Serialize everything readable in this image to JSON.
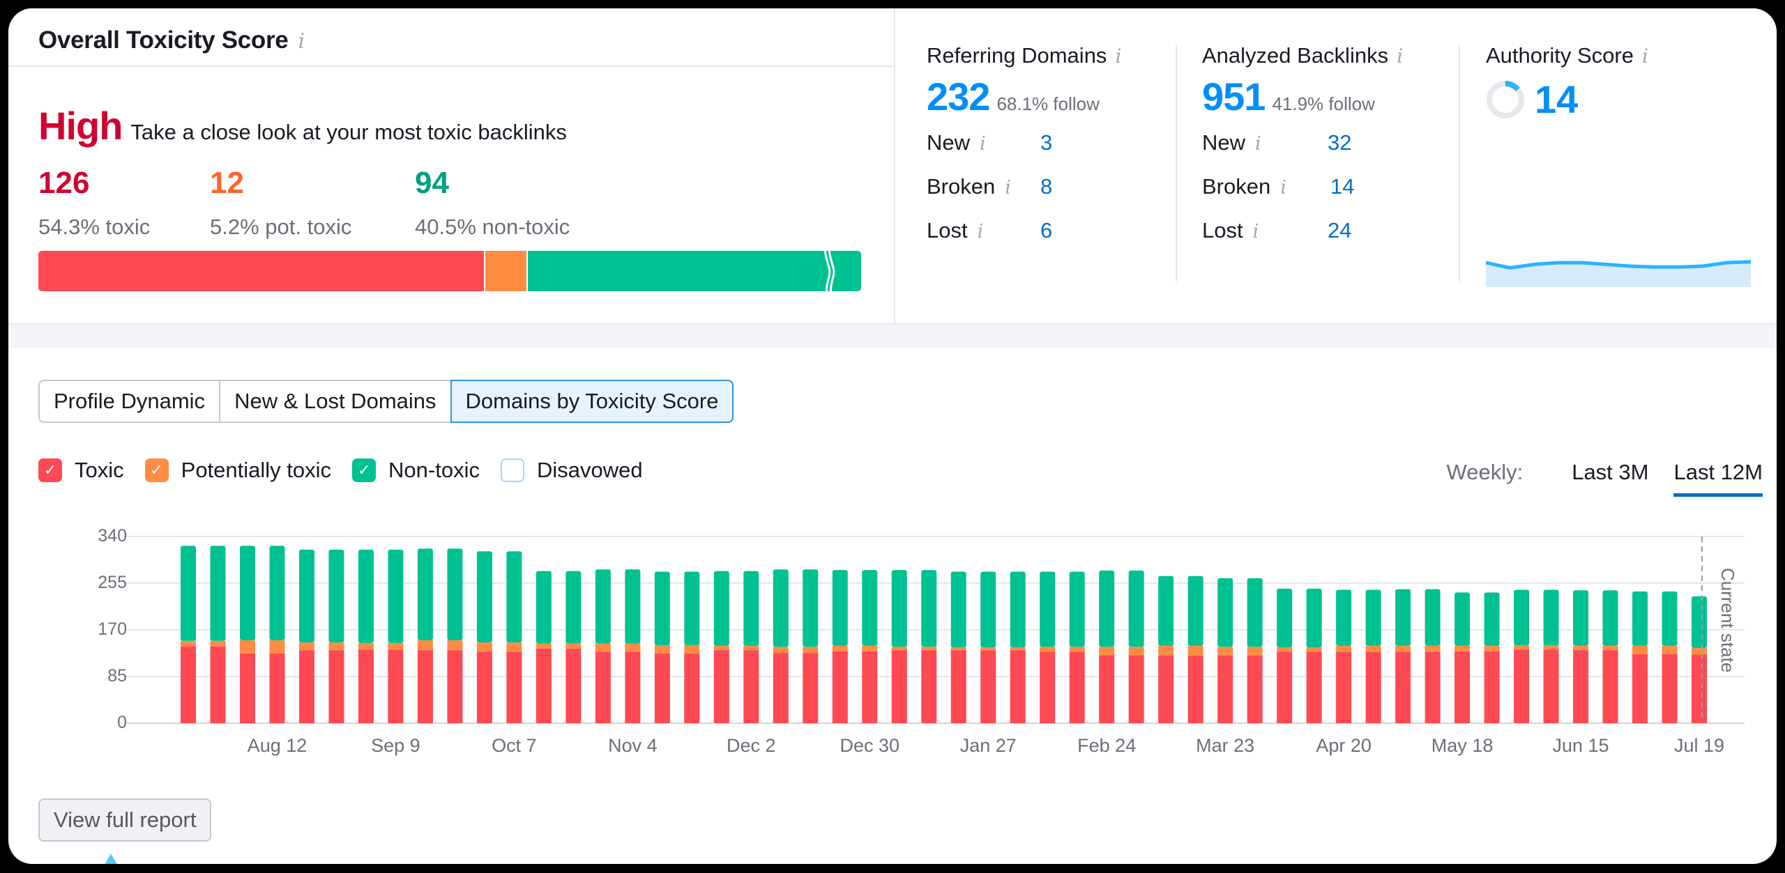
{
  "toxicity": {
    "title": "Overall Toxicity Score",
    "info_icon": "info-icon",
    "level": "High",
    "level_color": "#d1002f",
    "description": "Take a close look at your most toxic backlinks",
    "counts": [
      {
        "value": "126",
        "label": "54.3% toxic",
        "color": "#d1002f",
        "share": 54.3,
        "bar_color": "#ff4953"
      },
      {
        "value": "12",
        "label": "5.2% pot. toxic",
        "color": "#ff642d",
        "share": 5.2,
        "bar_color": "#ff8c43"
      },
      {
        "value": "94",
        "label": "40.5% non-toxic",
        "color": "#009f81",
        "share": 40.5,
        "bar_color": "#00c192"
      }
    ]
  },
  "metrics": [
    {
      "title": "Referring Domains",
      "value": "232",
      "sub": "68.1% follow",
      "rows": [
        {
          "label": "New",
          "value": "3"
        },
        {
          "label": "Broken",
          "value": "8"
        },
        {
          "label": "Lost",
          "value": "6"
        }
      ]
    },
    {
      "title": "Analyzed Backlinks",
      "value": "951",
      "sub": "41.9% follow",
      "rows": [
        {
          "label": "New",
          "value": "32"
        },
        {
          "label": "Broken",
          "value": "14"
        },
        {
          "label": "Lost",
          "value": "24"
        }
      ]
    },
    {
      "title": "Authority Score",
      "value": "14",
      "score_fraction": 0.14,
      "trend": [
        44,
        41,
        43,
        44,
        44,
        43,
        42,
        41.5,
        41.5,
        42,
        44,
        44.5
      ]
    }
  ],
  "tabs": [
    {
      "label": "Profile Dynamic",
      "active": false
    },
    {
      "label": "New & Lost Domains",
      "active": false
    },
    {
      "label": "Domains by Toxicity Score",
      "active": true
    }
  ],
  "legend": [
    {
      "label": "Toxic",
      "color": "#ff4953",
      "checked": true
    },
    {
      "label": "Potentially toxic",
      "color": "#ff8c43",
      "checked": true
    },
    {
      "label": "Non-toxic",
      "color": "#00c192",
      "checked": true
    },
    {
      "label": "Disavowed",
      "color": "#a8d7fa",
      "checked": false
    }
  ],
  "period": {
    "label": "Weekly:",
    "options": [
      {
        "label": "Last 3M",
        "active": false
      },
      {
        "label": "Last 12M",
        "active": true
      }
    ]
  },
  "chart_data": {
    "type": "bar",
    "stacked": true,
    "title": "Domains by Toxicity Score",
    "xlabel": "",
    "ylabel": "",
    "ylim": [
      0,
      340
    ],
    "yticks": [
      0,
      85,
      170,
      255,
      340
    ],
    "grid": true,
    "legend_position": "top-left",
    "xtick_labels": [
      {
        "label": "Aug 12",
        "index": 3
      },
      {
        "label": "Sep 9",
        "index": 7
      },
      {
        "label": "Oct 7",
        "index": 11
      },
      {
        "label": "Nov 4",
        "index": 15
      },
      {
        "label": "Dec 2",
        "index": 19
      },
      {
        "label": "Dec 30",
        "index": 23
      },
      {
        "label": "Jan 27",
        "index": 27
      },
      {
        "label": "Feb 24",
        "index": 31
      },
      {
        "label": "Mar 23",
        "index": 35
      },
      {
        "label": "Apr 20",
        "index": 39
      },
      {
        "label": "May 18",
        "index": 43
      },
      {
        "label": "Jun 15",
        "index": 47
      },
      {
        "label": "Jul 19",
        "index": 51
      }
    ],
    "annotation": "Current state",
    "series": [
      {
        "name": "Toxic",
        "color": "#ff4953",
        "values": [
          140,
          140,
          127,
          127,
          133,
          133,
          134,
          134,
          133,
          133,
          130,
          130,
          136,
          136,
          130,
          130,
          127,
          127,
          133,
          133,
          128,
          128,
          131,
          131,
          133,
          133,
          133,
          133,
          133,
          130,
          130,
          124,
          124,
          123,
          123,
          123,
          123,
          130,
          130,
          130,
          130,
          130,
          130,
          131,
          131,
          134,
          134,
          133,
          133,
          126,
          126,
          125
        ]
      },
      {
        "name": "Potentially toxic",
        "color": "#ff8c43",
        "values": [
          10,
          10,
          24,
          24,
          14,
          14,
          12,
          12,
          18,
          18,
          17,
          17,
          9,
          9,
          15,
          15,
          15,
          15,
          8,
          8,
          11,
          11,
          10,
          10,
          6,
          6,
          5,
          5,
          5,
          9,
          9,
          15,
          15,
          18,
          18,
          16,
          16,
          8,
          8,
          11,
          11,
          11,
          11,
          10,
          10,
          8,
          8,
          8,
          8,
          15,
          15,
          12
        ]
      },
      {
        "name": "Non-toxic",
        "color": "#00c192",
        "values": [
          173,
          173,
          172,
          172,
          169,
          169,
          170,
          170,
          167,
          167,
          166,
          166,
          132,
          132,
          135,
          135,
          134,
          134,
          136,
          136,
          141,
          141,
          138,
          138,
          140,
          140,
          138,
          138,
          138,
          137,
          137,
          139,
          139,
          127,
          127,
          125,
          125,
          107,
          107,
          102,
          102,
          103,
          103,
          97,
          97,
          101,
          101,
          101,
          101,
          99,
          99,
          94
        ]
      }
    ]
  },
  "footer": {
    "button_label": "View full report"
  }
}
